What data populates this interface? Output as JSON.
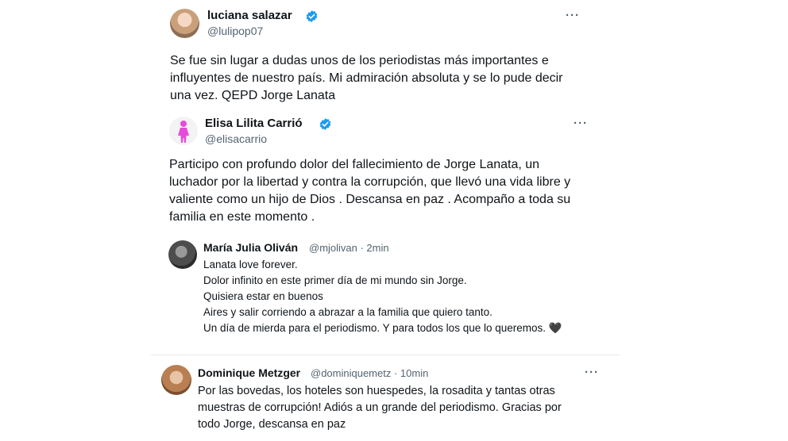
{
  "tweets": [
    {
      "name": "luciana salazar",
      "handle": "@lulipop07",
      "verified": true,
      "more_label": "···",
      "lines": [
        "Se fue sin lugar a dudas unos de los periodistas más importantes e",
        "influyentes de nuestro país. Mi admiración absoluta y se lo pude decir",
        "una vez. QEPD Jorge Lanata"
      ]
    },
    {
      "name": "Elisa Lilita Carrió",
      "handle": "@elisacarrio",
      "verified": true,
      "more_label": "···",
      "lines": [
        "Participo con profundo dolor del fallecimiento de Jorge Lanata, un",
        "luchador por la libertad y contra la corrupción, que llevó una vida libre y",
        "valiente como un hijo de Dios . Descansa en paz . Acompaño a toda su",
        "familia en este momento ."
      ]
    },
    {
      "name": "María Julia Oliván",
      "handle": "@mjolivan · 2min",
      "verified": false,
      "lines": [
        "Lanata love forever.",
        "Dolor infinito en este primer día de mi mundo sin Jorge.",
        "Quisiera estar en buenos",
        "Aires y salir corriendo a abrazar a la familia que quiero tanto.",
        "Un día de mierda para el periodismo. Y para todos los que lo queremos. 🖤"
      ]
    },
    {
      "name": "Dominique Metzger",
      "handle": "@dominiquemetz · 10min",
      "verified": false,
      "more_label": "···",
      "lines": [
        "Por las bovedas, los hoteles son huespedes, la rosadita y tantas otras",
        "muestras de corrupción! Adiós a un grande del periodismo. Gracias por",
        "todo Jorge, descansa en paz"
      ]
    }
  ],
  "colors": {
    "verified": "#1d9bf0",
    "handle": "#536471",
    "text": "#0f1419",
    "carrio_icon": "#e64bd8"
  },
  "icons": [
    "verified-badge-icon",
    "more-options-icon",
    "black-heart-icon",
    "woman-silhouette-icon"
  ]
}
